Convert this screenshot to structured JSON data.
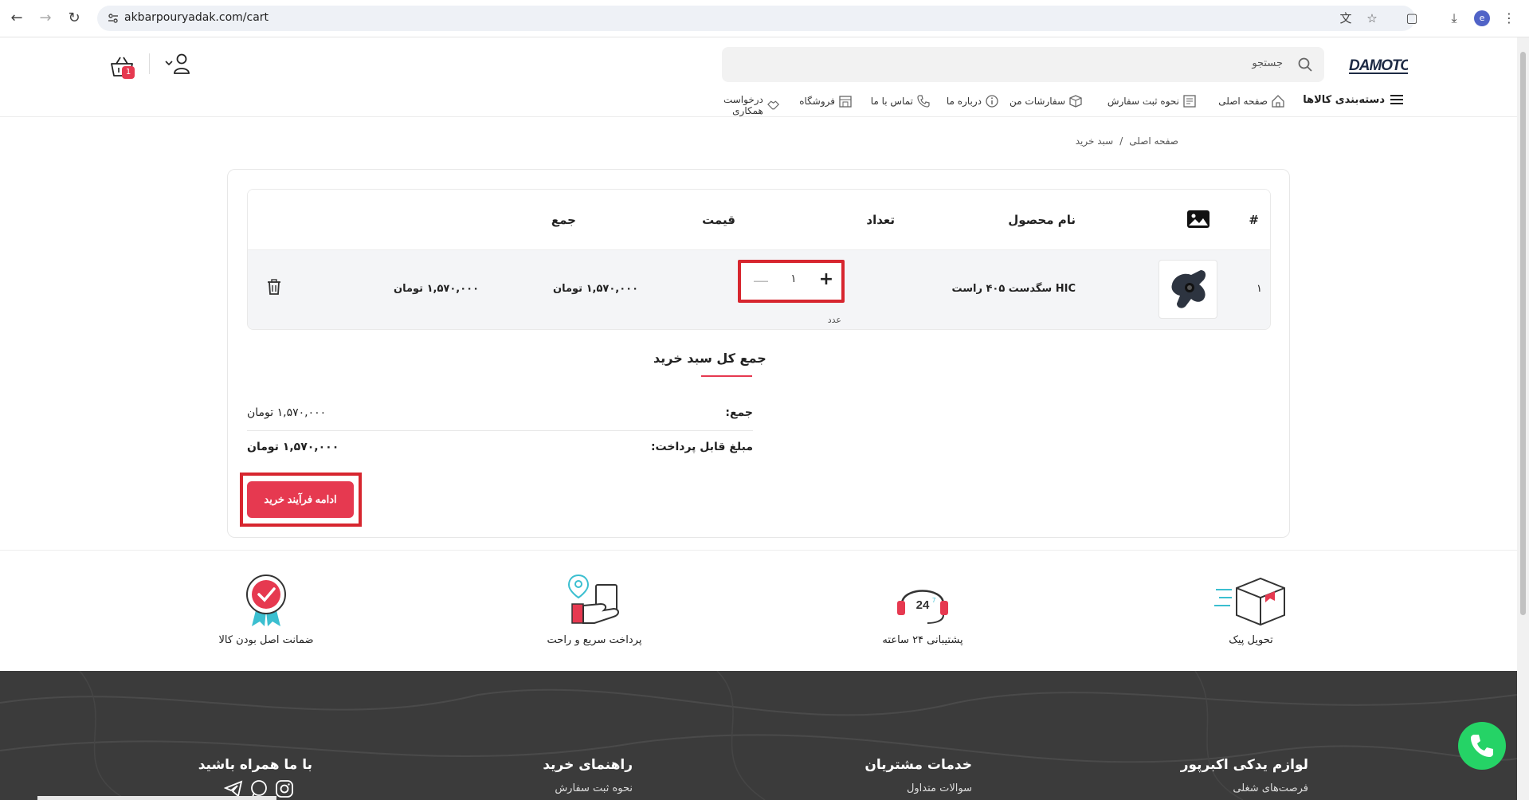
{
  "browser": {
    "url": "akbarpouryadak.com/cart",
    "profile_initial": "e"
  },
  "header": {
    "search_placeholder": "جستجو",
    "cart_count": "1",
    "logo_text": "DAMOTOR"
  },
  "nav": {
    "items": [
      {
        "label": "دسته‌بندی کالاها",
        "icon": "menu-icon"
      },
      {
        "label": "صفحه اصلی",
        "icon": "home-icon"
      },
      {
        "label": "نحوه ثبت سفارش",
        "icon": "order-guide-icon"
      },
      {
        "label": "سفارشات من",
        "icon": "box-icon"
      },
      {
        "label": "درباره ما",
        "icon": "info-icon"
      },
      {
        "label": "تماس با ما",
        "icon": "phone-icon"
      },
      {
        "label": "فروشگاه",
        "icon": "store-icon"
      },
      {
        "label": "درخواست همکاری",
        "icon": "handshake-icon"
      }
    ]
  },
  "breadcrumb": {
    "home": "صفحه اصلی",
    "separator": "/",
    "current": "سبد خرید"
  },
  "cart_table": {
    "headers": {
      "index": "#",
      "image": "image-icon",
      "name": "نام محصول",
      "quantity": "تعداد",
      "price": "قیمت",
      "total": "جمع"
    },
    "rows": [
      {
        "index": "۱",
        "name": "سگدست ۴۰۵ راست HIC",
        "quantity": "۱",
        "unit": "عدد",
        "price": "۱,۵۷۰,۰۰۰ تومان",
        "total": "۱,۵۷۰,۰۰۰ تومان"
      }
    ]
  },
  "summary": {
    "title": "جمع کل سبد خرید",
    "subtotal_label": "جمع:",
    "subtotal_value": "۱,۵۷۰,۰۰۰ تومان",
    "payable_label": "مبلغ قابل پرداخت:",
    "payable_value": "۱,۵۷۰,۰۰۰ تومان",
    "checkout_button": "ادامه فرآیند خرید"
  },
  "features": [
    {
      "label": "تحویل پیک",
      "icon": "delivery-box-icon"
    },
    {
      "label": "پشتیبانی ۲۴ ساعته",
      "icon": "support-24-icon"
    },
    {
      "label": "پرداخت سریع و راحت",
      "icon": "fast-payment-icon"
    },
    {
      "label": "ضمانت اصل بودن کالا",
      "icon": "guarantee-badge-icon"
    }
  ],
  "footer": {
    "col1_title": "لوازم یدکی اکبرپور",
    "col1_link": "فرصت‌های شغلی",
    "col2_title": "خدمات مشتریان",
    "col2_link": "سوالات متداول",
    "col3_title": "راهنمای خرید",
    "col3_link": "نحوه ثبت سفارش",
    "col4_title": "با ما همراه باشید"
  },
  "colors": {
    "accent": "#e63950",
    "highlight_frame": "#d7262f",
    "footer_bg": "#3b3b3b",
    "whatsapp": "#25d366"
  }
}
